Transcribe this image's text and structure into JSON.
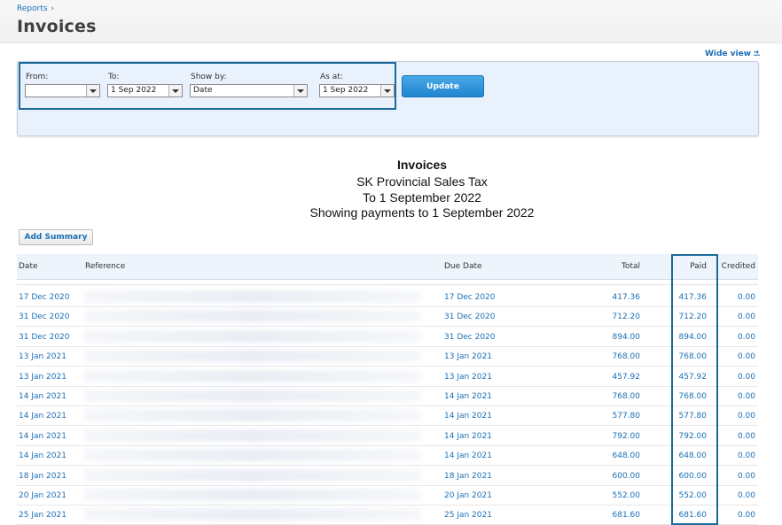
{
  "breadcrumb": {
    "parent": "Reports",
    "separator": "›"
  },
  "page": {
    "title": "Invoices"
  },
  "wide_view": {
    "label": "Wide view"
  },
  "filters": {
    "from": {
      "label": "From:",
      "value": ""
    },
    "to": {
      "label": "To:",
      "value": "1 Sep 2022"
    },
    "show_by": {
      "label": "Show by:",
      "value": "Date"
    },
    "as_at": {
      "label": "As at:",
      "value": "1 Sep 2022"
    },
    "update_label": "Update"
  },
  "report": {
    "title": "Invoices",
    "subtitle": "SK Provincial Sales Tax",
    "period": "To 1 September 2022",
    "payments_note": "Showing payments to 1 September 2022"
  },
  "add_summary_label": "Add Summary",
  "table": {
    "columns": [
      "Date",
      "Reference",
      "Due Date",
      "Total",
      "Paid",
      "Credited"
    ],
    "rows": [
      [
        "17 Dec 2020",
        "",
        "17 Dec 2020",
        "417.36",
        "417.36",
        "0.00"
      ],
      [
        "31 Dec 2020",
        "",
        "31 Dec 2020",
        "712.20",
        "712.20",
        "0.00"
      ],
      [
        "31 Dec 2020",
        "",
        "31 Dec 2020",
        "894.00",
        "894.00",
        "0.00"
      ],
      [
        "13 Jan 2021",
        "",
        "13 Jan 2021",
        "768.00",
        "768.00",
        "0.00"
      ],
      [
        "13 Jan 2021",
        "",
        "13 Jan 2021",
        "457.92",
        "457.92",
        "0.00"
      ],
      [
        "14 Jan 2021",
        "",
        "14 Jan 2021",
        "768.00",
        "768.00",
        "0.00"
      ],
      [
        "14 Jan 2021",
        "",
        "14 Jan 2021",
        "577.80",
        "577.80",
        "0.00"
      ],
      [
        "14 Jan 2021",
        "",
        "14 Jan 2021",
        "792.00",
        "792.00",
        "0.00"
      ],
      [
        "14 Jan 2021",
        "",
        "14 Jan 2021",
        "648.00",
        "648.00",
        "0.00"
      ],
      [
        "18 Jan 2021",
        "",
        "18 Jan 2021",
        "600.00",
        "600.00",
        "0.00"
      ],
      [
        "20 Jan 2021",
        "",
        "20 Jan 2021",
        "552.00",
        "552.00",
        "0.00"
      ],
      [
        "25 Jan 2021",
        "",
        "25 Jan 2021",
        "681.60",
        "681.60",
        "0.00"
      ]
    ]
  },
  "colors": {
    "link": "#1a6fb5",
    "highlight_border": "#1a6b99",
    "panel_bg": "#e9f1fd",
    "button": "#1f86d0"
  }
}
